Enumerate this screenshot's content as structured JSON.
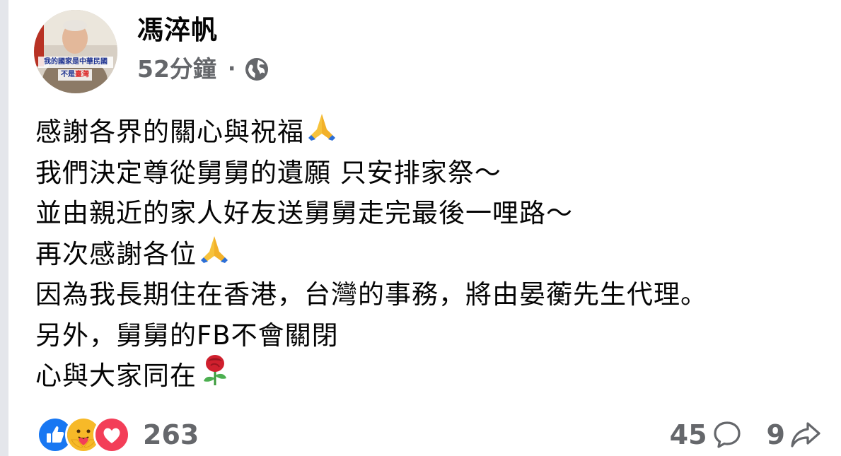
{
  "post": {
    "author": "馮淬帆",
    "time": "52分鐘",
    "separator": "·",
    "visibility_icon": "globe-icon",
    "avatar_caption": {
      "top": "我的國家是中華民國",
      "bottom_prefix": "不是",
      "bottom_highlight": "臺灣"
    },
    "lines": [
      {
        "text": "感謝各界的關心與祝福",
        "emoji": "folded-hands"
      },
      {
        "text": "我們決定尊從舅舅的遺願 只安排家祭～",
        "emoji": ""
      },
      {
        "text": "並由親近的家人好友送舅舅走完最後一哩路～",
        "emoji": ""
      },
      {
        "text": "再次感謝各位",
        "emoji": "folded-hands"
      },
      {
        "text": "因為我長期住在香港，台灣的事務，將由晏蘅先生代理。",
        "emoji": ""
      },
      {
        "text": "另外，舅舅的FB不會關閉",
        "emoji": ""
      },
      {
        "text": "心與大家同在",
        "emoji": "rose"
      }
    ]
  },
  "footer": {
    "reaction_icons": [
      "like-icon",
      "care-icon",
      "love-icon"
    ],
    "reaction_count": "263",
    "comment_count": "45",
    "share_count": "9"
  },
  "colors": {
    "like": "#1877f2",
    "love": "#f33e58",
    "care": "#f7b928",
    "secondary_text": "#65676b"
  }
}
